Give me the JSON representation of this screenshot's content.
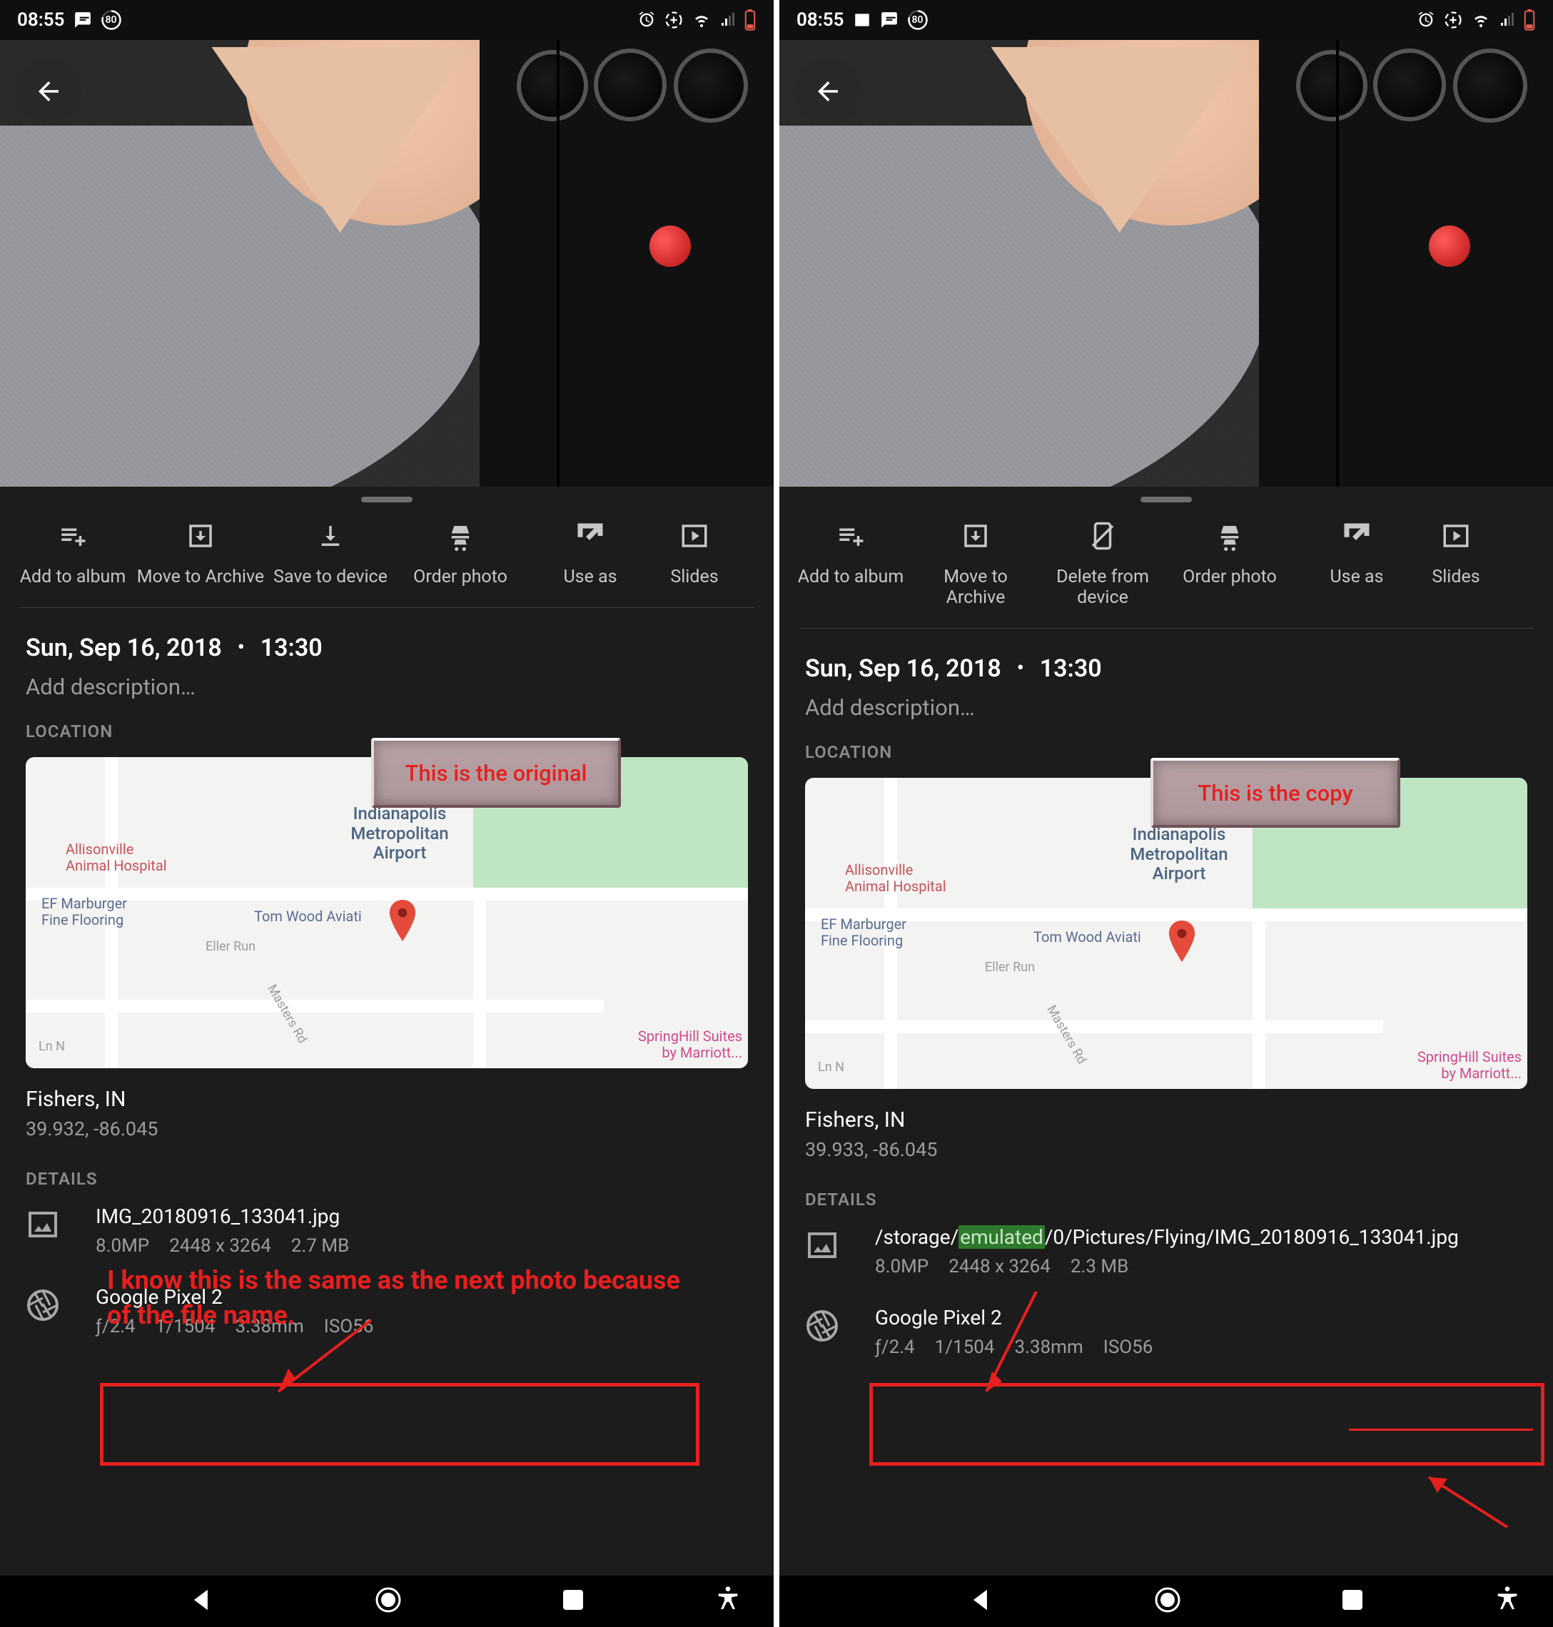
{
  "left": {
    "statusbar": {
      "time": "08:55",
      "icons_left": [
        "message-icon",
        "battery-ring-80-icon"
      ],
      "icons_right": [
        "alarm-icon",
        "data-saver-icon",
        "wifi-icon",
        "signal-icon",
        "battery-low-icon"
      ],
      "battery_ring_text": "80"
    },
    "actions": [
      {
        "icon": "playlist-add-icon",
        "label": "Add to album"
      },
      {
        "icon": "archive-icon",
        "label": "Move to Archive"
      },
      {
        "icon": "download-icon",
        "label": "Save to device"
      },
      {
        "icon": "cart-icon",
        "label": "Order photo"
      },
      {
        "icon": "open-in-new-icon",
        "label": "Use as"
      },
      {
        "icon": "slideshow-icon",
        "label": "Slides"
      }
    ],
    "date": "Sun, Sep 16, 2018",
    "time_taken": "13:30",
    "description_placeholder": "Add description…",
    "location_label": "LOCATION",
    "map": {
      "pois": {
        "airport": "Indianapolis\nMetropolitan\nAirport",
        "hospital": "Allisonville\nAnimal Hospital",
        "flooring": "EF Marburger\nFine Flooring",
        "wood": "Tom Wood Aviati",
        "eller": "Eller Run",
        "masters": "Masters Rd",
        "lnn": "Ln N",
        "hotel": "SpringHill Suites\nby Marriott..."
      }
    },
    "location_text": "Fishers, IN",
    "coords": "39.932, -86.045",
    "details_label": "DETAILS",
    "file": {
      "name": "IMG_20180916_133041.jpg",
      "mp": "8.0MP",
      "dims": "2448 x 3264",
      "size": "2.7 MB"
    },
    "device": {
      "name": "Google Pixel 2",
      "aperture": "ƒ/2.4",
      "shutter": "1/1504",
      "focal": "3.38mm",
      "iso": "ISO56"
    },
    "callout": "This is the original",
    "annotation": "I know this is the same as the next photo because of the file name."
  },
  "right": {
    "statusbar": {
      "time": "08:55",
      "icons_left": [
        "picture-icon",
        "message-icon",
        "battery-ring-80-icon"
      ],
      "icons_right": [
        "alarm-icon",
        "data-saver-icon",
        "wifi-icon",
        "signal-icon",
        "battery-low-icon"
      ],
      "battery_ring_text": "80"
    },
    "actions": [
      {
        "icon": "playlist-add-icon",
        "label": "Add to album"
      },
      {
        "icon": "archive-icon",
        "label": "Move to Archive"
      },
      {
        "icon": "remove-device-icon",
        "label": "Delete from device"
      },
      {
        "icon": "cart-icon",
        "label": "Order photo"
      },
      {
        "icon": "open-in-new-icon",
        "label": "Use as"
      },
      {
        "icon": "slideshow-icon",
        "label": "Slides"
      }
    ],
    "date": "Sun, Sep 16, 2018",
    "time_taken": "13:30",
    "description_placeholder": "Add description…",
    "location_label": "LOCATION",
    "map": {
      "pois": {
        "airport": "Indianapolis\nMetropolitan\nAirport",
        "hospital": "Allisonville\nAnimal Hospital",
        "flooring": "EF Marburger\nFine Flooring",
        "wood": "Tom Wood Aviati",
        "eller": "Eller Run",
        "masters": "Masters Rd",
        "lnn": "Ln N",
        "hotel": "SpringHill Suites\nby Marriott..."
      }
    },
    "location_text": "Fishers, IN",
    "coords": "39.933, -86.045",
    "details_label": "DETAILS",
    "file": {
      "prefix": "/storage/",
      "highlight": "emulated",
      "suffix": "/0/Pictures/Flying/IMG_20180916_133041.jpg",
      "mp": "8.0MP",
      "dims": "2448 x 3264",
      "size": "2.3 MB"
    },
    "device": {
      "name": "Google Pixel 2",
      "aperture": "ƒ/2.4",
      "shutter": "1/1504",
      "focal": "3.38mm",
      "iso": "ISO56"
    },
    "callout": "This is the copy"
  }
}
